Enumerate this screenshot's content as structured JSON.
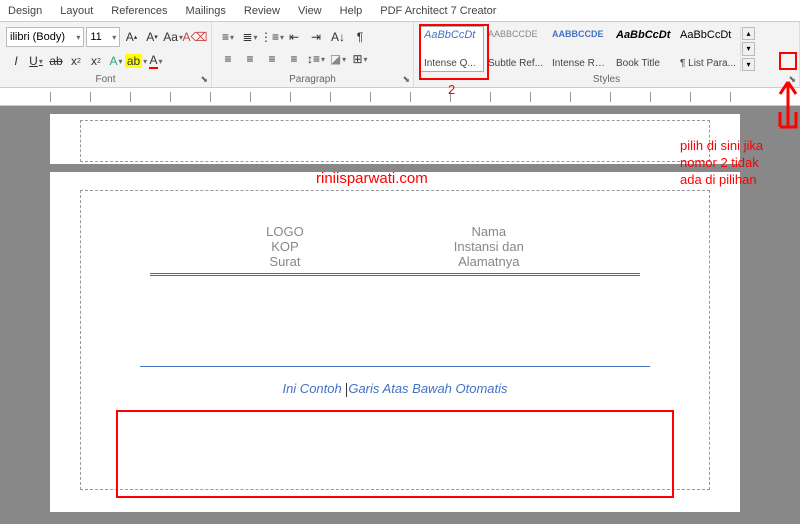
{
  "tabs": [
    "Design",
    "Layout",
    "References",
    "Mailings",
    "Review",
    "View",
    "Help",
    "PDF Architect 7 Creator"
  ],
  "font": {
    "name": "ilibri (Body)",
    "size": "11",
    "group_label": "Font"
  },
  "paragraph": {
    "group_label": "Paragraph"
  },
  "styles": {
    "group_label": "Styles",
    "items": [
      {
        "preview": "AaBbCcDt",
        "name": "Intense Q...",
        "css": "color:#4472c4;font-style:italic;"
      },
      {
        "preview": "AABBCCDE",
        "name": "Subtle Ref...",
        "css": "color:#888;font-size:9px;"
      },
      {
        "preview": "AABBCCDE",
        "name": "Intense Re...",
        "css": "color:#4472c4;font-size:9px;font-weight:bold;"
      },
      {
        "preview": "AaBbCcDt",
        "name": "Book Title",
        "css": "font-weight:bold;font-style:italic;"
      },
      {
        "preview": "AaBbCcDt",
        "name": "¶ List Para...",
        "css": ""
      }
    ]
  },
  "doc": {
    "kop_left": [
      "LOGO",
      "KOP",
      "Surat"
    ],
    "kop_right": [
      "Nama",
      "Instansi dan",
      "Alamatnya"
    ],
    "quote_before": "Ini Contoh ",
    "quote_after": "Garis Atas Bawah Otomatis"
  },
  "annot": {
    "watermark": "riniisparwati.com",
    "num2": "2",
    "hint": "pilih di sini jika\nnomor 2 tidak\nada di pilihan"
  }
}
